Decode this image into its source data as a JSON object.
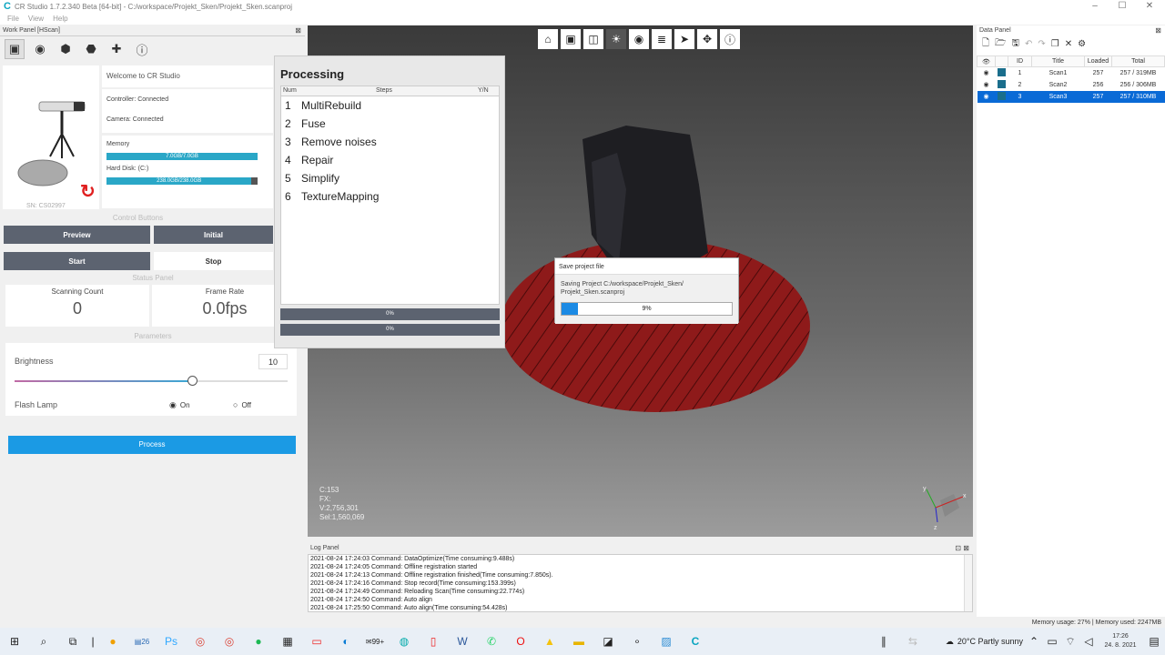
{
  "window": {
    "app_icon": "C",
    "title": "CR Studio 1.7.2.340 Beta [64-bit]  -  C:/workspace/Projekt_Sken/Projekt_Sken.scanproj",
    "controls": [
      "–",
      "☐",
      "✕"
    ]
  },
  "menu": [
    "File",
    "View",
    "Help"
  ],
  "work_panel": {
    "title": "Work Panel [HScan]",
    "close": "⊠",
    "toolbar_icons": [
      "box-icon",
      "eye-icon",
      "cube-icon",
      "shape-icon",
      "puzzle-icon",
      "info-icon"
    ],
    "serial": "SN: CS02997",
    "welcome": "Welcome to CR Studio",
    "controller": "Controller: Connected",
    "camera": "Camera: Connected",
    "memory_label": "Memory",
    "memory_value": "7.0GB/7.0GB",
    "memory_fraction": 1.0,
    "disk_label": "Hard Disk: (C:)",
    "disk_value": "238.0GB/238.0GB",
    "disk_fraction": 0.96,
    "control_buttons_label": "Control Buttons",
    "preview": "Preview",
    "initial": "Initial",
    "start": "Start",
    "stop": "Stop",
    "status_panel_label": "Status Panel",
    "scanning_count_label": "Scanning Count",
    "scanning_count": "0",
    "frame_rate_label": "Frame Rate",
    "frame_rate": "0.0fps",
    "parameters_label": "Parameters",
    "brightness_label": "Brightness",
    "brightness_value": "10",
    "brightness_fraction": 0.65,
    "flash_label": "Flash Lamp",
    "flash_on": "On",
    "flash_off": "Off",
    "process": "Process"
  },
  "viewport": {
    "toolbar_icons": [
      "home-icon",
      "front-view-icon",
      "perspective-icon",
      "light-icon",
      "eye-icon",
      "layers-icon",
      "select-cursor-icon",
      "move-icon",
      "info-icon"
    ],
    "stats": [
      "C:153",
      "FX:",
      "V:2,756,301",
      "Sel:1,560,069"
    ],
    "axis_labels": [
      "y",
      "z",
      "x"
    ]
  },
  "processing": {
    "title": "Processing",
    "col_num": "Num",
    "col_steps": "Steps",
    "col_yn": "Y/N",
    "steps": [
      {
        "num": "1",
        "name": "MultiRebuild"
      },
      {
        "num": "2",
        "name": "Fuse"
      },
      {
        "num": "3",
        "name": "Remove noises"
      },
      {
        "num": "4",
        "name": "Repair"
      },
      {
        "num": "5",
        "name": "Simplify"
      },
      {
        "num": "6",
        "name": "TextureMapping"
      }
    ],
    "progress1": "0%",
    "progress2": "0%"
  },
  "save_dialog": {
    "title": "Save project file",
    "message_line1": "Saving Project C:/workspace/Projekt_Sken/",
    "message_line2": "Projekt_Sken.scanproj",
    "percent": "9%",
    "fraction": 0.09
  },
  "log_panel": {
    "title": "Log Panel",
    "close": "⊡ ⊠",
    "lines": [
      "2021-08-24 17:24:03 Command: DataOptimize(Time consuming:9.488s)",
      "2021-08-24 17:24:05 Command: Offline registration started",
      "2021-08-24 17:24:13 Command: Offline registration finished(Time consuming:7.850s).",
      "2021-08-24 17:24:16 Command: Stop record(Time consuming:153.399s)",
      "2021-08-24 17:24:49 Command: Reloading Scan(Time consuming:22.774s)",
      "2021-08-24 17:24:50 Command: Auto align",
      "2021-08-24 17:25:50 Command: Auto align(Time consuming:54.428s)"
    ]
  },
  "data_panel": {
    "title": "Data Panel",
    "close": "⊠",
    "toolbar_icons": [
      "new-file-icon",
      "open-folder-icon",
      "save-icon",
      "undo-icon",
      "redo-icon",
      "copy-icon",
      "delete-icon",
      "settings-icon"
    ],
    "headers": [
      "",
      "",
      "ID",
      "Title",
      "Loaded",
      "Total"
    ],
    "rows": [
      {
        "id": "1",
        "title": "Scan1",
        "loaded": "257",
        "total": "257 / 319MB"
      },
      {
        "id": "2",
        "title": "Scan2",
        "loaded": "256",
        "total": "256 / 306MB"
      },
      {
        "id": "3",
        "title": "Scan3",
        "loaded": "257",
        "total": "257 / 310MB"
      }
    ],
    "selected_row": 2
  },
  "statusbar": "Memory usage: 27% | Memory used: 2247MB",
  "taskbar": {
    "weather": "20°C  Partly sunny",
    "time": "17:26",
    "date": "24. 8. 2021",
    "badge_a": "26",
    "badge_b": "99+"
  }
}
